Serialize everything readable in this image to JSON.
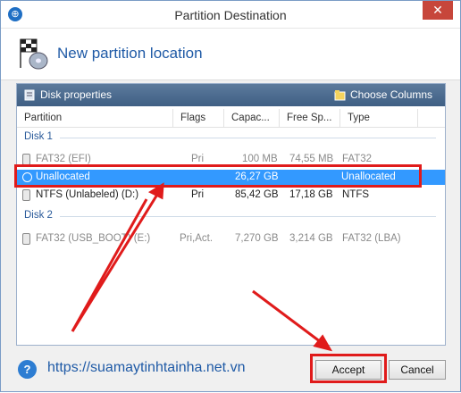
{
  "window": {
    "title": "Partition Destination",
    "close_label": "✕"
  },
  "header": {
    "title": "New partition location"
  },
  "toolbar": {
    "disk_properties": "Disk properties",
    "choose_columns": "Choose Columns"
  },
  "columns": [
    "Partition",
    "Flags",
    "Capac...",
    "Free Sp...",
    "Type"
  ],
  "disks": [
    {
      "label": "Disk 1",
      "rows": [
        {
          "partition": "FAT32 (EFI)",
          "flags": "Pri",
          "capacity": "100 MB",
          "free": "74,55 MB",
          "type": "FAT32",
          "state": "dim"
        },
        {
          "partition": "Unallocated",
          "flags": "",
          "capacity": "26,27 GB",
          "free": "",
          "type": "Unallocated",
          "state": "selected"
        },
        {
          "partition": "NTFS (Unlabeled) (D:)",
          "flags": "Pri",
          "capacity": "85,42 GB",
          "free": "17,18 GB",
          "type": "NTFS",
          "state": "normal"
        }
      ]
    },
    {
      "label": "Disk 2",
      "rows": [
        {
          "partition": "FAT32 (USB_BOOT) (E:)",
          "flags": "Pri,Act.",
          "capacity": "7,270 GB",
          "free": "3,214 GB",
          "type": "FAT32 (LBA)",
          "state": "dim"
        }
      ]
    }
  ],
  "footer": {
    "link": "https://suamaytinhtainha.net.vn",
    "accept_label": "Accept",
    "cancel_label": "Cancel"
  },
  "icons": {
    "app": "app-icon",
    "header": "checkered-flag-disk-icon",
    "disk_properties": "disk-properties-icon",
    "choose_columns": "choose-columns-icon",
    "help": "help-icon"
  },
  "colors": {
    "accent": "#1f5aa6",
    "selection": "#3399ff",
    "annotation": "#e01b1b"
  }
}
